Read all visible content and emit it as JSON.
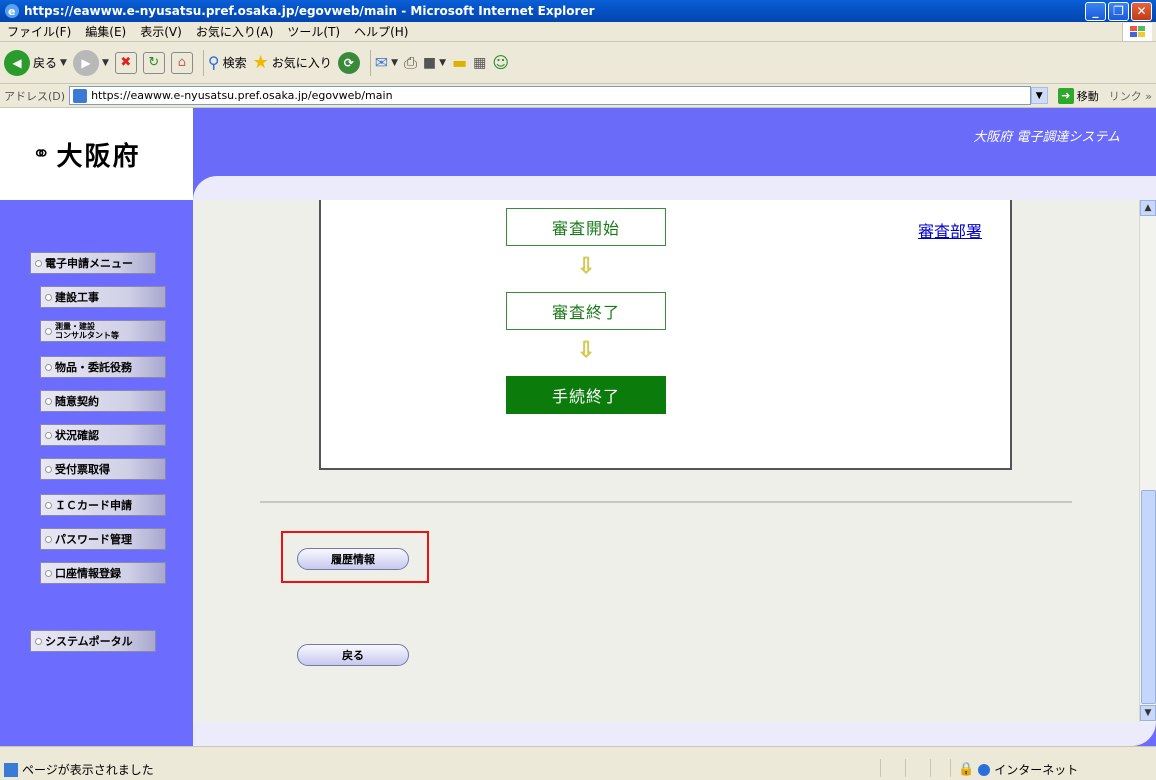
{
  "window": {
    "title": "https://eawww.e-nyusatsu.pref.osaka.jp/egovweb/main - Microsoft Internet Explorer"
  },
  "menu": [
    "ファイル(F)",
    "編集(E)",
    "表示(V)",
    "お気に入り(A)",
    "ツール(T)",
    "ヘルプ(H)"
  ],
  "toolbar": {
    "back": "戻る",
    "search": "検索",
    "favorites": "お気に入り"
  },
  "address": {
    "label": "アドレス(D)",
    "url": "https://eawww.e-nyusatsu.pref.osaka.jp/egovweb/main",
    "go": "移動",
    "links": "リンク"
  },
  "header": {
    "logo_mark": "⚭",
    "logo": "大阪府",
    "system_name": "大阪府 電子調達システム"
  },
  "sidebar": {
    "menu_title": "電子申請メニュー",
    "items": [
      "建設工事",
      "測量・建設\nコンサルタント等",
      "物品・委託役務",
      "随意契約",
      "状況確認",
      "受付票取得",
      "ＩＣカード申請",
      "パスワード管理",
      "口座情報登録"
    ],
    "portal": "システムポータル"
  },
  "flow": {
    "steps": [
      "審査開始",
      "審査終了",
      "手続終了"
    ],
    "department": "審査部署"
  },
  "buttons": {
    "history": "履歴情報",
    "back": "戻る"
  },
  "status": {
    "text": "ページが表示されました",
    "zone": "インターネット"
  }
}
